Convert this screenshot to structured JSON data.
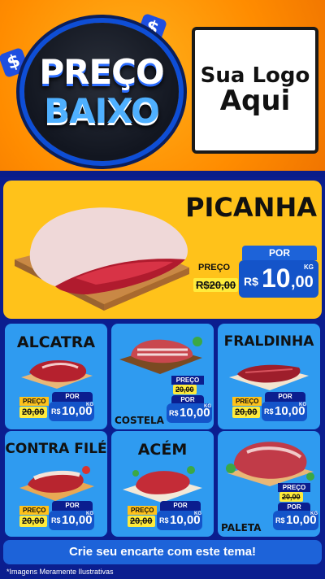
{
  "header": {
    "badge_line1": "PREÇO",
    "badge_line2": "BAIXO",
    "dollar_symbol": "$",
    "logo_line1": "Sua Logo",
    "logo_line2": "Aqui"
  },
  "hero": {
    "name": "PICANHA",
    "old_label": "PREÇO",
    "old_price": "R$20,00",
    "por": "POR",
    "currency": "R$",
    "price_int": "10",
    "price_dec": ",00",
    "unit": "KG"
  },
  "products": [
    {
      "name": "ALCATRA",
      "old_label": "PREÇO",
      "old_price": "20,00",
      "por": "POR",
      "currency": "R$",
      "price": "10,00",
      "unit": "KG"
    },
    {
      "name": "COSTELA",
      "old_label": "PREÇO",
      "old_price": "20,00",
      "por": "POR",
      "currency": "R$",
      "price": "10,00",
      "unit": "KG"
    },
    {
      "name": "FRALDINHA",
      "old_label": "PREÇO",
      "old_price": "20,00",
      "por": "POR",
      "currency": "R$",
      "price": "10,00",
      "unit": "KG"
    },
    {
      "name": "CONTRA FILÉ",
      "old_label": "PREÇO",
      "old_price": "20,00",
      "por": "POR",
      "currency": "R$",
      "price": "10,00",
      "unit": "KG"
    },
    {
      "name": "ACÉM",
      "old_label": "PREÇO",
      "old_price": "20,00",
      "por": "POR",
      "currency": "R$",
      "price": "10,00",
      "unit": "KG"
    },
    {
      "name": "PALETA",
      "old_label": "PREÇO",
      "old_price": "20,00",
      "por": "POR",
      "currency": "R$",
      "price": "10,00",
      "unit": "KG"
    }
  ],
  "cta_text": "Crie seu encarte com este tema!",
  "footnote": "*Imagens Meramente Ilustrativas",
  "colors": {
    "orange": "#ff8c00",
    "yellow": "#ffc21a",
    "blue_dark": "#0b1e8f",
    "blue_card": "#2f9bf0",
    "price_blue": "#1454c9"
  }
}
